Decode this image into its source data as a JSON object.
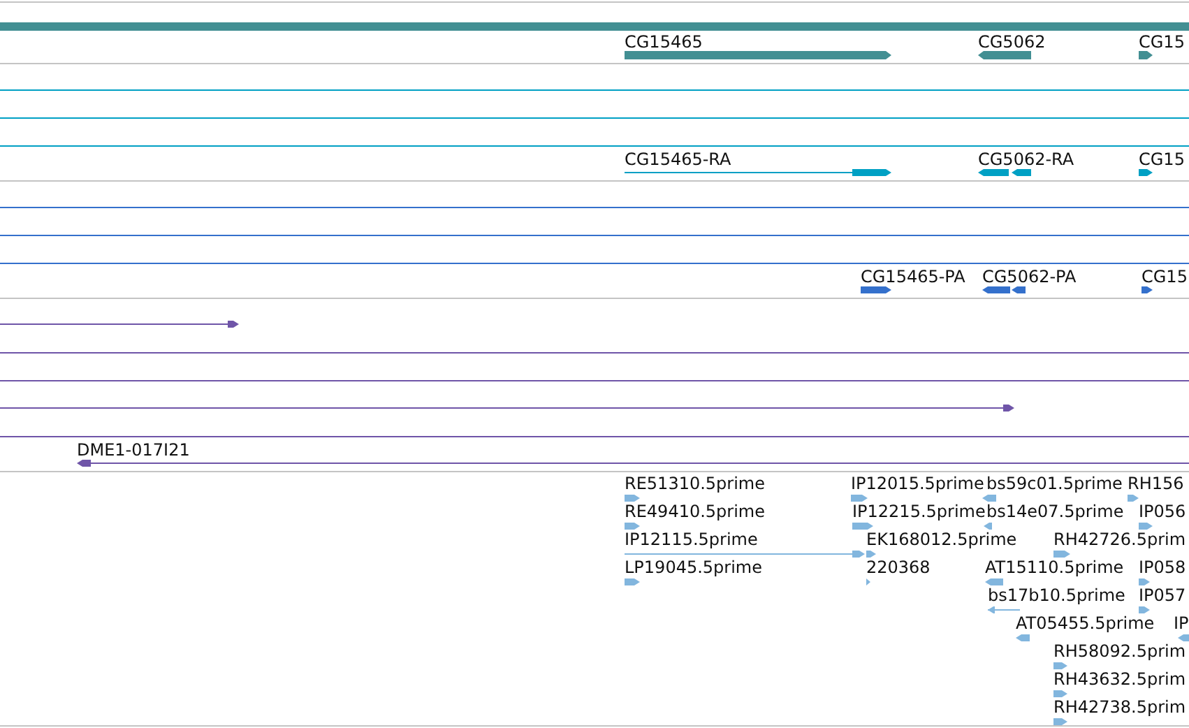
{
  "tracks": [
    {
      "kind": "gene",
      "features": [
        {
          "label": "CG15465",
          "reverse": false
        },
        {
          "label": "CG5062",
          "reverse": true
        },
        {
          "label": "CG15",
          "reverse": false
        }
      ]
    },
    {
      "kind": "transcript",
      "features": [
        {
          "label": "CG15465-RA",
          "reverse": false
        },
        {
          "label": "CG5062-RA",
          "reverse": true
        },
        {
          "label": "CG15",
          "reverse": false
        }
      ]
    },
    {
      "kind": "protein",
      "features": [
        {
          "label": "CG15465-PA",
          "reverse": false
        },
        {
          "label": "CG5062-PA",
          "reverse": true
        },
        {
          "label": "CG15",
          "reverse": false
        }
      ]
    },
    {
      "kind": "clone",
      "features": [
        {
          "reverse": false
        },
        {
          "reverse": false
        },
        {
          "label": "DME1-017I21",
          "reverse": true
        }
      ]
    },
    {
      "kind": "est",
      "features": [
        {
          "label": "RE51310.5prime",
          "reverse": false
        },
        {
          "label": "IP12015.5prime",
          "reverse": false
        },
        {
          "label": "bs59c01.5prime",
          "reverse": true
        },
        {
          "label": "RH156",
          "reverse": false
        },
        {
          "label": "RE49410.5prime",
          "reverse": false
        },
        {
          "label": "IP12215.5prime",
          "reverse": false
        },
        {
          "label": "bs14e07.5prime",
          "reverse": true
        },
        {
          "label": "IP056",
          "reverse": false
        },
        {
          "label": "IP12115.5prime",
          "reverse": false
        },
        {
          "label": "EK168012.5prime",
          "reverse": false
        },
        {
          "label": "RH42726.5prim",
          "reverse": false
        },
        {
          "label": "LP19045.5prime",
          "reverse": false
        },
        {
          "label": "220368",
          "reverse": false
        },
        {
          "label": "AT15110.5prime",
          "reverse": true
        },
        {
          "label": "IP058",
          "reverse": false
        },
        {
          "label": "bs17b10.5prime",
          "reverse": true
        },
        {
          "label": "IP057",
          "reverse": false
        },
        {
          "label": "AT05455.5prime",
          "reverse": true
        },
        {
          "label": "IP",
          "reverse": true
        },
        {
          "label": "RH58092.5prim",
          "reverse": false
        },
        {
          "label": "RH43632.5prim",
          "reverse": false
        },
        {
          "label": "RH42738.5prim",
          "reverse": false
        }
      ]
    }
  ]
}
